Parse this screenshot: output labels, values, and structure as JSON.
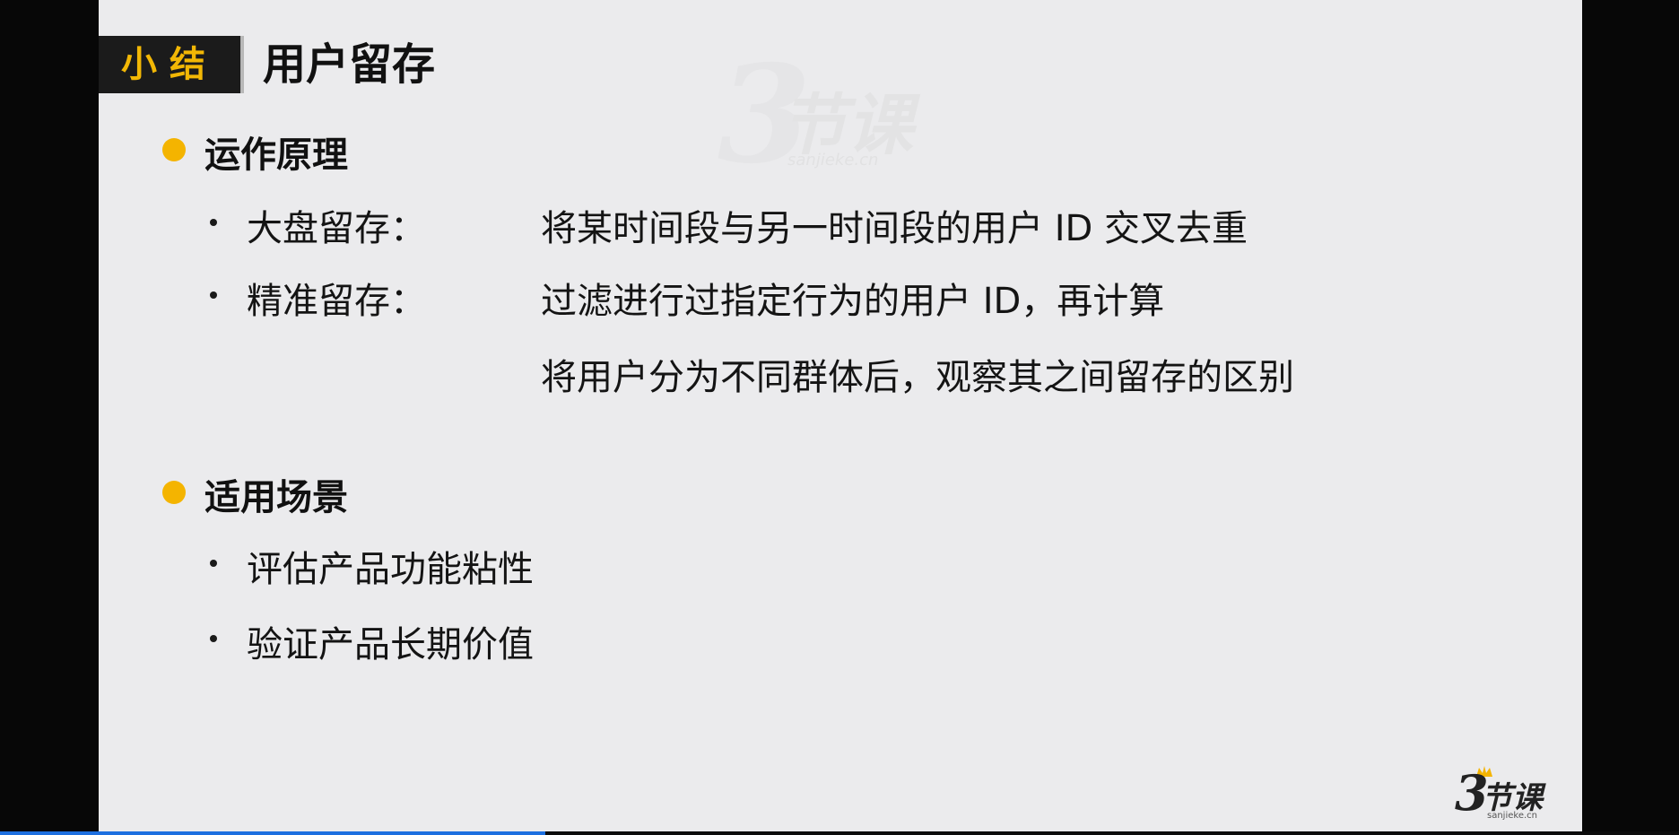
{
  "slide": {
    "badge": "小结",
    "title": "用户留存",
    "sections": [
      {
        "title": "运作原理",
        "items": [
          {
            "label": "大盘留存：",
            "lines": [
              "将某时间段与另一时间段的用户 ID 交叉去重"
            ]
          },
          {
            "label": "精准留存：",
            "lines": [
              "过滤进行过指定行为的用户 ID，再计算",
              "将用户分为不同群体后，观察其之间留存的区别"
            ]
          }
        ]
      },
      {
        "title": "适用场景",
        "items": [
          {
            "label": "评估产品功能粘性",
            "lines": []
          },
          {
            "label": "验证产品长期价值",
            "lines": []
          }
        ]
      }
    ],
    "watermark": {
      "mark": "3",
      "text": "节课",
      "domain": "sanjieke.cn"
    },
    "logo": {
      "mark": "3",
      "text": "节课",
      "domain": "sanjieke.cn"
    }
  },
  "video": {
    "progress": 0.325
  },
  "colors": {
    "accent": "#f4b400",
    "badge_bg": "#1b1b1b",
    "badge_text": "#f2b705",
    "slide_bg": "#ebebed",
    "progress": "#1d6fe0"
  }
}
